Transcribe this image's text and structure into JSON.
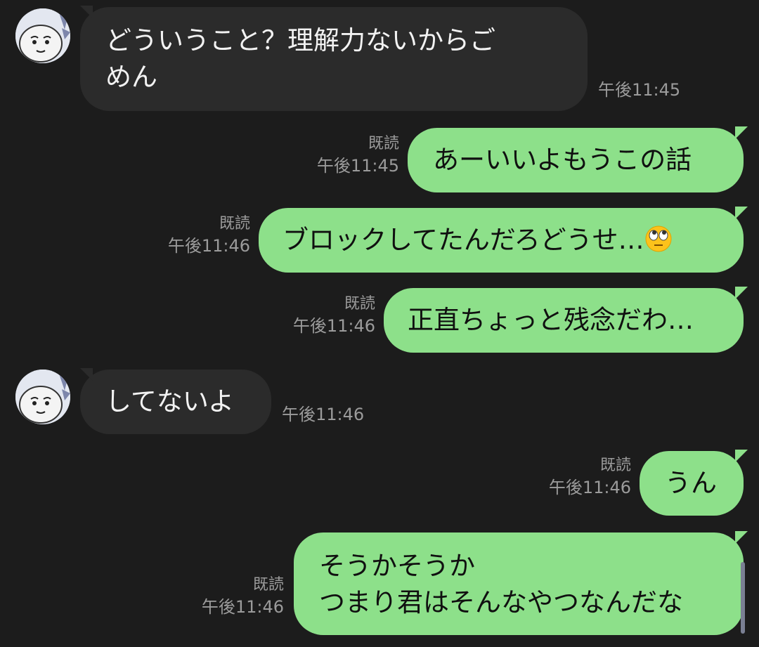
{
  "messages": [
    {
      "dir": "in",
      "lines": [
        "どういうこと？理解力ないからご",
        "めん"
      ],
      "time": "午後11:45"
    },
    {
      "dir": "out",
      "lines": [
        "あーいいよもうこの話"
      ],
      "read": "既読",
      "time": "午後11:45"
    },
    {
      "dir": "out",
      "lines": [
        "ブロックしてたんだろどうせ…"
      ],
      "emoji": "face-with-rolling-eyes",
      "read": "既読",
      "time": "午後11:46"
    },
    {
      "dir": "out",
      "lines": [
        "正直ちょっと残念だわ…"
      ],
      "read": "既読",
      "time": "午後11:46"
    },
    {
      "dir": "in",
      "lines": [
        "してないよ"
      ],
      "time": "午後11:46"
    },
    {
      "dir": "out",
      "lines": [
        "うん"
      ],
      "read": "既読",
      "time": "午後11:46"
    },
    {
      "dir": "out",
      "lines": [
        "そうかそうか",
        "つまり君はそんなやつなんだな"
      ],
      "read": "既読",
      "time": "午後11:46"
    }
  ],
  "colors": {
    "background": "#1c1c1c",
    "incoming": "#2b2b2b",
    "outgoing": "#8de08a",
    "meta": "#9b9b9b"
  }
}
